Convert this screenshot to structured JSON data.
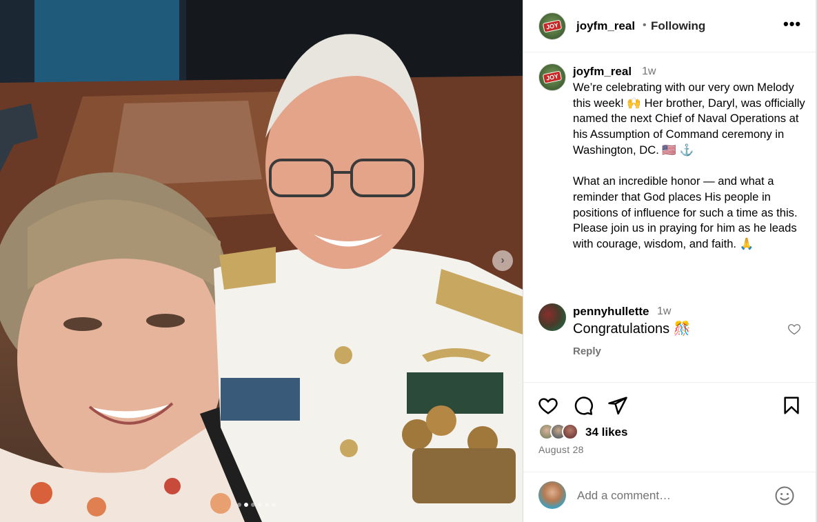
{
  "post": {
    "username": "joyfm_real",
    "separator": "•",
    "follow_status": "Following",
    "more_label": "•••",
    "avatar_logo_text": "JOY",
    "caption_time": "1w",
    "caption": "We’re celebrating with our very own Melody this week! 🙌 Her brother, Daryl, was officially named the next Chief of Naval Operations at his Assumption of Command ceremony in Washington, DC. 🇺🇸 ⚓️\n\nWhat an incredible honor — and what a reminder that God places His people in positions of influence for such a time as this. Please join us in praying for him as he leads with courage, wisdom, and faith. 🙏",
    "carousel": {
      "next_label": "›",
      "slide_count": 6,
      "active_index": 1
    }
  },
  "comments": [
    {
      "username": "pennyhullette",
      "time": "1w",
      "text": "Congratulations 🎊",
      "reply_label": "Reply"
    }
  ],
  "actions": {
    "like_icon": "heart-icon",
    "comment_icon": "comment-icon",
    "share_icon": "send-icon",
    "save_icon": "bookmark-icon"
  },
  "engagement": {
    "likes": "34 likes",
    "date": "August 28"
  },
  "composer": {
    "placeholder": "Add a comment…",
    "emoji_icon": "smiley-icon"
  },
  "colors": {
    "secondary_text": "#737373",
    "divider": "#efefef"
  }
}
